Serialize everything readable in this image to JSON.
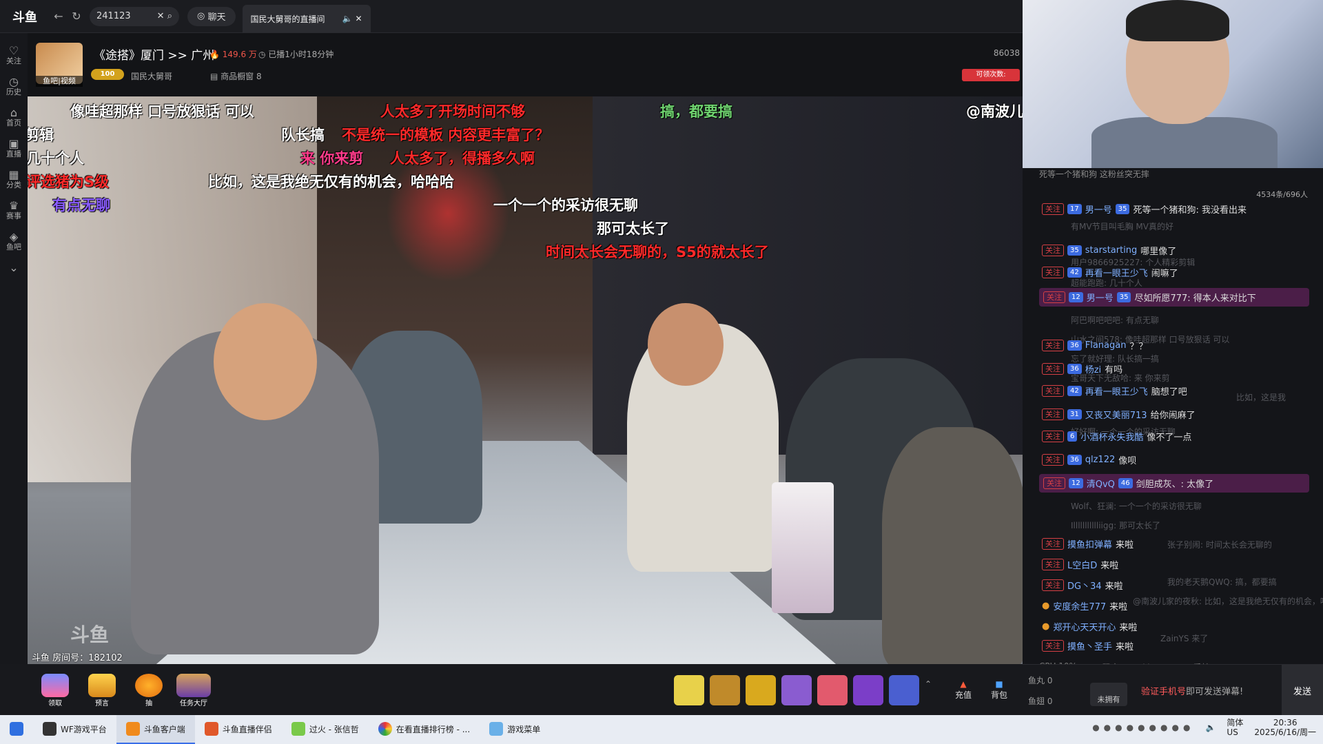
{
  "header": {
    "logo": "斗鱼",
    "search_value": "241123",
    "chat_pill": "聊天",
    "tab_title": "国民大舅哥的直播间"
  },
  "left_rail": [
    {
      "label": "关注",
      "icon": "heart-icon"
    },
    {
      "label": "历史",
      "icon": "clock-icon"
    },
    {
      "label": "首页",
      "icon": "home-icon"
    },
    {
      "label": "直播",
      "icon": "tv-icon"
    },
    {
      "label": "分类",
      "icon": "grid-icon"
    },
    {
      "label": "赛事",
      "icon": "trophy-icon"
    },
    {
      "label": "鱼吧",
      "icon": "fish-icon"
    }
  ],
  "room": {
    "avatar_label": "鱼吧|视频",
    "title": "《途搭》厦门 >> 广州",
    "hot": "149.6 万",
    "live_duration": "已播1小时18分钟",
    "level": "100",
    "anchor": "国民大舅哥",
    "goods": "商品橱窗 8",
    "room_code_partial": "86038",
    "free_btn": "可领次数:"
  },
  "video": {
    "watermark": "斗鱼",
    "room_number": "斗鱼 房间号：182102",
    "danmu": [
      {
        "text": "像哇超那样  口号放狠话  可以",
        "color": "#ffffff"
      },
      {
        "text": "人太多了开场时间不够",
        "color": "#ff2a2a"
      },
      {
        "text": "搞，都要搞",
        "color": "#6fd36f"
      },
      {
        "text": "@南波儿",
        "color": "#ffffff"
      },
      {
        "text": "剪辑",
        "color": "#ffffff"
      },
      {
        "text": "队长搞",
        "color": "#ffffff"
      },
      {
        "text": "不是统一的模板  内容更丰富了？",
        "color": "#ff2a2a"
      },
      {
        "text": "几十个人",
        "color": "#ffffff"
      },
      {
        "text": "来  你来剪",
        "color": "#ff3b8a"
      },
      {
        "text": "人太多了，得播多久啊",
        "color": "#ff2a2a"
      },
      {
        "text": "评选猪为S级",
        "color": "#ff2a2a"
      },
      {
        "text": "比如，这是我绝无仅有的机会，哈哈哈",
        "color": "#ffffff"
      },
      {
        "text": "有点无聊",
        "color": "#8a5cff"
      },
      {
        "text": "一个一个的采访很无聊",
        "color": "#ffffff"
      },
      {
        "text": "那可太长了",
        "color": "#ffffff"
      },
      {
        "text": "时间太长会无聊的，S5的就太长了",
        "color": "#ff2a2a"
      }
    ]
  },
  "chat": {
    "top_note": "死等一个猪和狗 这粉丝突无摔",
    "stats": "4534条/696人",
    "messages": [
      {
        "user": "男一号",
        "level": "17",
        "medal": "35",
        "text": "死等一个猪和狗: 我没看出来",
        "highlight": false
      },
      {
        "user": "starstarting",
        "level": "35",
        "text": "哪里像了",
        "highlight": false
      },
      {
        "user": "再看一眼王少飞",
        "level": "42",
        "text": "闹嘛了",
        "highlight": false
      },
      {
        "user": "男一号",
        "level": "12",
        "medal": "35",
        "text": "尽如所愿777: 得本人来对比下",
        "highlight": true
      },
      {
        "user": "Flanagan",
        "level": "36",
        "text": "？？",
        "highlight": false
      },
      {
        "user": "杨zi",
        "level": "36",
        "text": "有吗",
        "highlight": false
      },
      {
        "user": "再看一眼王少飞",
        "level": "42",
        "text": "脑想了吧",
        "highlight": false
      },
      {
        "user": "又丧又美丽713",
        "level": "31",
        "text": "给你闹麻了",
        "highlight": false
      },
      {
        "user": "小酒杯永失我酷",
        "level": "6",
        "text": "像不了一点",
        "highlight": false
      },
      {
        "user": "qlz122",
        "level": "36",
        "text": "像呗",
        "highlight": false
      },
      {
        "user": "清QvQ",
        "level": "12",
        "medal": "46",
        "text": "剑胆成灰、: 太像了",
        "highlight": true
      }
    ],
    "ghost_lines": [
      "有MV节目叫毛胸 MV真的好",
      "用户9866925227: 个人精彩剪辑",
      "超能跑跑: 几十个人",
      "阿巴啊吧吧吧: 有点无聊",
      "山水之间578: 像哇超那样 口号放狠话 可以",
      "忘了就好理: 队长搞一搞",
      "宝哥天下无敌哈: 来 你来剪",
      "比如，这是我",
      "好好啊: 一个一个的采访无聊",
      "Wolf、狂澜: 一个一个的采访很无聊",
      "Illllllllllliigg: 那可太长了",
      "张子别闹: 时间太长会无聊的",
      "我的老天鹅QWQ: 搞，都要搞",
      "@南波儿家的夜秋: 比如，这是我绝无仅有的机会，哈哈哈",
      "ZainYS 来了"
    ],
    "enters": [
      {
        "user": "摸鱼扣弹幕",
        "text": "来啦"
      },
      {
        "user": "L空白D",
        "text": "来啦"
      },
      {
        "user": "DG丶34",
        "text": "来啦"
      },
      {
        "user": "安度余生777",
        "text": "来啦"
      },
      {
        "user": "郑开心天天开心",
        "text": "来啦"
      },
      {
        "user": "摸鱼丶圣手",
        "text": "来啦"
      }
    ],
    "follow_label": "关注",
    "footer_stats": "码率 4339kb/s    FPS 30    丢帧 0.00%",
    "cpu": "CPU 10%"
  },
  "bottom": {
    "actions": [
      "领取",
      "预言",
      "抽",
      "任务大厅"
    ],
    "charge": "充值",
    "bag": "背包",
    "fish_ball": "鱼丸 0",
    "fish_fin": "鱼翅 0",
    "no_badge": "未拥有"
  },
  "input": {
    "verify_prefix": "验证手机号",
    "verify_suffix": "即可发送弹幕!",
    "send": "发送"
  },
  "taskbar": {
    "apps": [
      "WF游戏平台",
      "斗鱼客户端",
      "斗鱼直播伴侣",
      "过火 - 张信哲",
      "在看直播排行榜 - ...",
      "游戏菜单"
    ],
    "ime": "简体",
    "locale": "US",
    "time": "20:36",
    "date": "2025/6/16/周一"
  }
}
